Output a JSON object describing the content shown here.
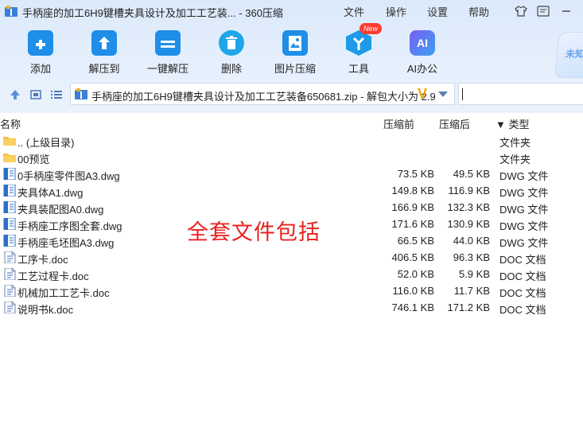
{
  "window": {
    "title": "手柄座的加工6H9键槽夹具设计及加工工艺装... - 360压缩",
    "menus": [
      "文件",
      "操作",
      "设置",
      "帮助"
    ]
  },
  "toolbar": {
    "items": [
      {
        "label": "添加",
        "icon": "add-icon",
        "color": "#1e8ee8"
      },
      {
        "label": "解压到",
        "icon": "extract-to-icon",
        "color": "#1e8ee8"
      },
      {
        "label": "一键解压",
        "icon": "one-click-extract-icon",
        "color": "#1e8ee8"
      },
      {
        "label": "删除",
        "icon": "trash-icon",
        "color": "#1ea6e8"
      },
      {
        "label": "图片压缩",
        "icon": "image-compress-icon",
        "color": "#1e8ee8"
      },
      {
        "label": "工具",
        "icon": "tools-icon",
        "color": "#1e9ae8"
      },
      {
        "label": "AI办公",
        "icon": "ai-office-icon",
        "color": "#6a5cf0"
      }
    ],
    "new_badge": "New",
    "side_badge": "未知"
  },
  "address": {
    "path": "手柄座的加工6H9键槽夹具设计及加工工艺装备650681.zip - 解包大小为 2.9"
  },
  "columns": {
    "name": "名称",
    "compressed": "压缩前",
    "packed": "压缩后",
    "type": "▼ 类型"
  },
  "files": [
    {
      "name": ".. (上级目录)",
      "compressed": "",
      "packed": "",
      "type": "文件夹",
      "kind": "folder"
    },
    {
      "name": "00预览",
      "compressed": "",
      "packed": "",
      "type": "文件夹",
      "kind": "folder"
    },
    {
      "name": "0手柄座零件图A3.dwg",
      "compressed": "73.5 KB",
      "packed": "49.5 KB",
      "type": "DWG 文件",
      "kind": "dwg"
    },
    {
      "name": "夹具体A1.dwg",
      "compressed": "149.8 KB",
      "packed": "116.9 KB",
      "type": "DWG 文件",
      "kind": "dwg"
    },
    {
      "name": "夹具装配图A0.dwg",
      "compressed": "166.9 KB",
      "packed": "132.3 KB",
      "type": "DWG 文件",
      "kind": "dwg"
    },
    {
      "name": "手柄座工序图全套.dwg",
      "compressed": "171.6 KB",
      "packed": "130.9 KB",
      "type": "DWG 文件",
      "kind": "dwg"
    },
    {
      "name": "手柄座毛坯图A3.dwg",
      "compressed": "66.5 KB",
      "packed": "44.0 KB",
      "type": "DWG 文件",
      "kind": "dwg"
    },
    {
      "name": "工序卡.doc",
      "compressed": "406.5 KB",
      "packed": "96.3 KB",
      "type": "DOC 文档",
      "kind": "doc"
    },
    {
      "name": "工艺过程卡.doc",
      "compressed": "52.0 KB",
      "packed": "5.9 KB",
      "type": "DOC 文档",
      "kind": "doc"
    },
    {
      "name": "机械加工工艺卡.doc",
      "compressed": "116.0 KB",
      "packed": "11.7 KB",
      "type": "DOC 文档",
      "kind": "doc"
    },
    {
      "name": "说明书k.doc",
      "compressed": "746.1 KB",
      "packed": "171.2 KB",
      "type": "DOC 文档",
      "kind": "doc"
    }
  ],
  "overlay_text": "全套文件包括"
}
